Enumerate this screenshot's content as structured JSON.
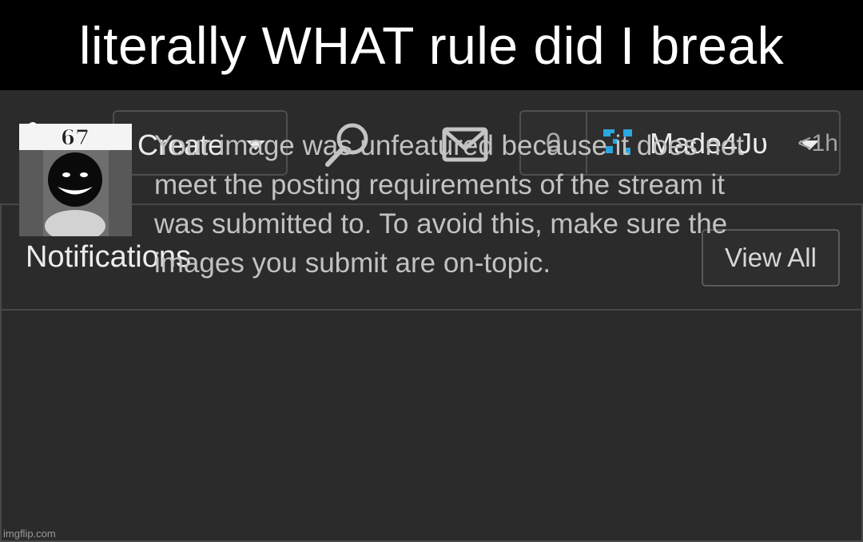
{
  "caption": "literally WHAT rule did I break",
  "navbar": {
    "logo_text": "im",
    "create_label": "Create",
    "search_icon": "search-icon",
    "messages_icon": "envelope-icon",
    "notification_count": "0",
    "username": "Made4Jυ"
  },
  "notifications": {
    "title": "Notifications",
    "view_all_label": "View All",
    "items": [
      {
        "thumbnail_label": "67",
        "text": "Your image was unfeatured because it does not meet the posting requirements of the stream it was submitted to. To avoid this, make sure the images you submit are on-topic.",
        "time": "<1h"
      }
    ]
  },
  "watermark": "imgflip.com",
  "colors": {
    "background": "#2b2b2b",
    "caption_bg": "#000000",
    "logo_red": "#e8191f",
    "avatar_blue": "#2aa6e0"
  }
}
